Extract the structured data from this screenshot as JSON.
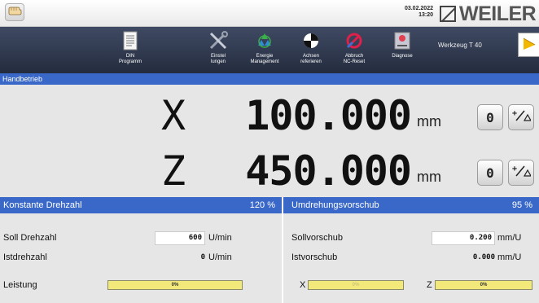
{
  "header": {
    "date": "03.02.2022",
    "time": "13:20",
    "brand": "WEILER"
  },
  "toolbar": {
    "buttons": [
      {
        "label": "DIN\nProgramm",
        "icon": "document-icon"
      },
      {
        "label": "Einstel\nlungen",
        "icon": "tools-icon"
      },
      {
        "label": "Energie\nManagement",
        "icon": "recycle-icon"
      },
      {
        "label": "Achsen\nreferieren",
        "icon": "target-icon"
      },
      {
        "label": "Abbruch\nNC-Reset",
        "icon": "stop-icon"
      },
      {
        "label": "Diagnose",
        "icon": "diagnosis-icon"
      }
    ],
    "tool_label": "Werkzeug T 40"
  },
  "mode": "Handbetrieb",
  "axes": [
    {
      "name": "X",
      "value": "100.000",
      "unit": "mm",
      "zero": "0",
      "btn2": "⁺⁄△"
    },
    {
      "name": "Z",
      "value": "450.000",
      "unit": "mm",
      "zero": "0",
      "btn2": "⁺⁄△"
    }
  ],
  "left_panel": {
    "title": "Konstante Drehzahl",
    "percent": "120 %",
    "soll_label": "Soll Drehzahl",
    "soll_value": "600",
    "soll_unit": "U/min",
    "ist_label": "Istdrehzahl",
    "ist_value": "0",
    "ist_unit": "U/min",
    "leistung_label": "Leistung",
    "leistung_value": "0%",
    "leistung_fraction": 0
  },
  "right_panel": {
    "title": "Umdrehungsvorschub",
    "percent": "95 %",
    "soll_label": "Sollvorschub",
    "soll_value": "0.200",
    "soll_unit": "mm/U",
    "ist_label": "Istvorschub",
    "ist_value": "0.000",
    "ist_unit": "mm/U",
    "x_label": "X",
    "x_bar_value": "0%",
    "z_label": "Z",
    "z_bar_value": "0%"
  },
  "colors": {
    "accent_blue": "#3a68c8",
    "toolbar_dark": "#2b3346",
    "bar_yellow": "#f2e97a"
  }
}
